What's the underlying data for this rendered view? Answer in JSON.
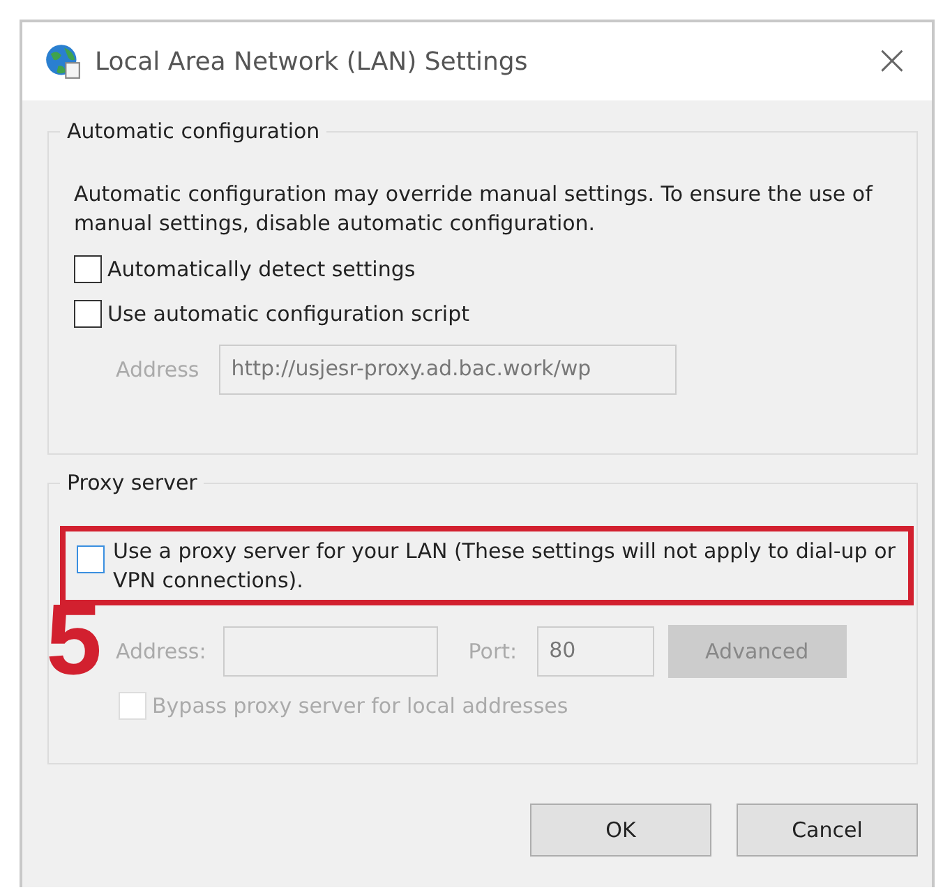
{
  "window": {
    "title": "Local Area Network (LAN) Settings",
    "close": "×"
  },
  "automatic": {
    "legend": "Automatic configuration",
    "description": "Automatic configuration may override manual settings.  To ensure the use of manual settings, disable automatic configuration.",
    "options": [
      {
        "label": "Automatically detect settings",
        "checked": false
      },
      {
        "label": "Use automatic configuration script",
        "checked": false
      }
    ],
    "address": {
      "label": "Address",
      "value": "http://usjesr-proxy.ad.bac.work/wp",
      "disabled": true
    }
  },
  "proxy": {
    "legend": "Proxy server",
    "use_proxy": {
      "label": "Use a proxy server for your LAN (These settings will not apply to dial-up or VPN connections).",
      "checked": false,
      "highlighted": true
    },
    "address": {
      "label": "Address:",
      "disabled": true
    },
    "port": {
      "label": "Port:",
      "value": "80",
      "disabled": true
    },
    "advanced": {
      "label": "Advanced",
      "disabled": true
    },
    "bypass": {
      "label": "Bypass proxy server for local addresses",
      "checked": false,
      "disabled": true
    }
  },
  "step_number": "5",
  "buttons": [
    "OK",
    "Cancel"
  ]
}
